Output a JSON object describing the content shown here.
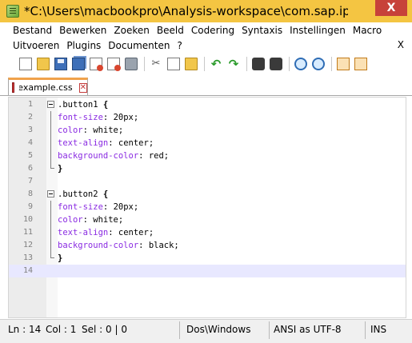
{
  "window": {
    "title": "*C:\\Users\\macbookpro\\Analysis-workspace\\com.sap.ip.b...",
    "close_label": "X"
  },
  "menu": {
    "row1": [
      "Bestand",
      "Bewerken",
      "Zoeken",
      "Beeld",
      "Codering",
      "Syntaxis",
      "Instellingen",
      "Macro"
    ],
    "row2": [
      "Uitvoeren",
      "Plugins",
      "Documenten",
      "?"
    ],
    "close_doc_label": "X"
  },
  "toolbar": {
    "icons": [
      "new-file-icon",
      "open-folder-icon",
      "save-icon",
      "save-all-icon",
      "close-icon",
      "close-all-icon",
      "print-icon",
      "cut-icon",
      "copy-icon",
      "paste-icon",
      "undo-icon",
      "redo-icon",
      "find-icon",
      "replace-icon",
      "zoom-in-icon",
      "zoom-out-icon",
      "sync-vertical-icon",
      "sync-horizontal-icon"
    ]
  },
  "tab": {
    "label": "example.css",
    "close_label": "✕"
  },
  "editor": {
    "lines": [
      {
        "number": "1",
        "selector": ".button1",
        "brace": "{"
      },
      {
        "number": "2",
        "property": "font-size",
        "value": "20px"
      },
      {
        "number": "3",
        "property": "color",
        "value": "white"
      },
      {
        "number": "4",
        "property": "text-align",
        "value": "center"
      },
      {
        "number": "5",
        "property": "background-color",
        "value": "red"
      },
      {
        "number": "6",
        "closing": "}"
      },
      {
        "number": "7"
      },
      {
        "number": "8",
        "selector": ".button2",
        "brace": "{"
      },
      {
        "number": "9",
        "property": "font-size",
        "value": "20px"
      },
      {
        "number": "10",
        "property": "color",
        "value": "white"
      },
      {
        "number": "11",
        "property": "text-align",
        "value": "center"
      },
      {
        "number": "12",
        "property": "background-color",
        "value": "black"
      },
      {
        "number": "13",
        "closing": "}"
      },
      {
        "number": "14"
      }
    ],
    "current_line": "14"
  },
  "status": {
    "ln": "Ln : 14",
    "col": "Col : 1",
    "sel": "Sel : 0 | 0",
    "eol": "Dos\\Windows",
    "encoding": "ANSI as UTF-8",
    "mode": "INS"
  }
}
